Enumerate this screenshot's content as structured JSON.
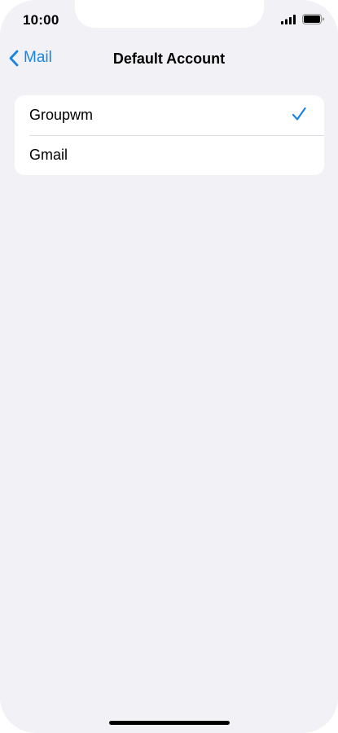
{
  "status_bar": {
    "time": "10:00",
    "icons": [
      "cellular-signal-icon",
      "battery-icon"
    ]
  },
  "nav": {
    "back_label": "Mail",
    "title": "Default Account"
  },
  "accounts": [
    {
      "label": "Groupwm",
      "selected": true
    },
    {
      "label": "Gmail",
      "selected": false
    }
  ],
  "colors": {
    "accent": "#1a84e5",
    "background": "#f1f1f6",
    "card": "#ffffff",
    "separator": "#dcdce0"
  }
}
